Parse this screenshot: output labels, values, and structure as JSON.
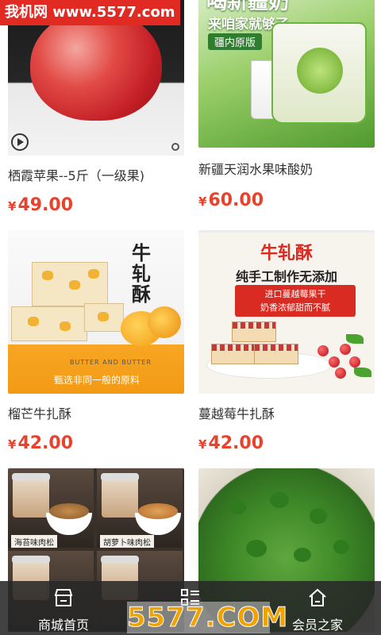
{
  "watermarks": {
    "top_left": "我机网 www.5577.com",
    "bottom_center": "5577.COM"
  },
  "products": [
    {
      "name": "栖霞苹果--5斤（一级果)",
      "currency": "¥",
      "price": "49.00"
    },
    {
      "name": "新疆天润水果味酸奶",
      "currency": "¥",
      "price": "60.00",
      "image_text": {
        "title": "喝新疆奶",
        "subtitle": "来咱家就够了",
        "tag": "疆内原版"
      }
    },
    {
      "name": "榴芒牛扎酥",
      "currency": "¥",
      "price": "42.00",
      "image_text": {
        "title": "牛轧酥",
        "band_small": "BUTTER AND BUTTER",
        "band": "甄选非同一般的原料"
      }
    },
    {
      "name": "蔓越莓牛扎酥",
      "currency": "¥",
      "price": "42.00",
      "image_text": {
        "title": "牛轧酥",
        "subtitle": "纯手工制作无添加",
        "box_line1": "进口蔓越莓果干",
        "box_line2": "奶香浓郁甜而不腻"
      }
    },
    {
      "name": "",
      "currency": "",
      "price": "",
      "image_text": {
        "label1": "海苔味肉松",
        "label2": "胡萝卜味肉松"
      }
    },
    {
      "name": "",
      "currency": "",
      "price": ""
    }
  ],
  "bottom_nav": {
    "items": [
      {
        "label": "商城首页",
        "icon": "store-icon"
      },
      {
        "label": "",
        "icon": "category-list-icon"
      },
      {
        "label": "会员之家",
        "icon": "home-icon"
      }
    ]
  }
}
